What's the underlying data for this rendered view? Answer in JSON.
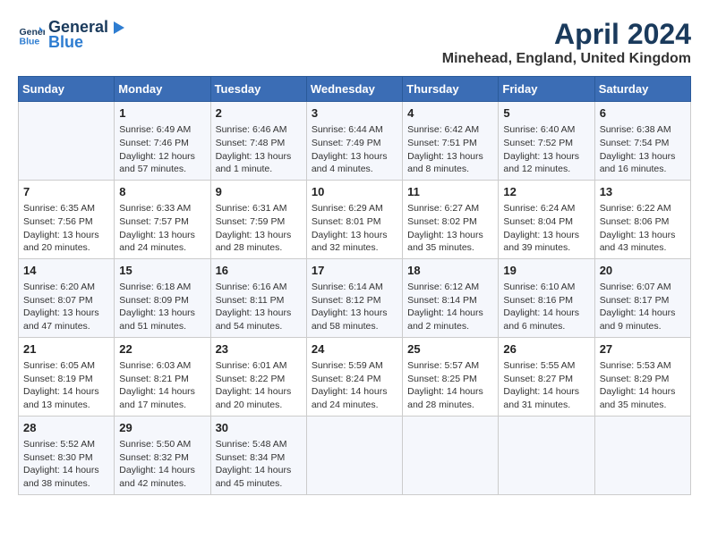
{
  "header": {
    "logo_line1": "General",
    "logo_line2": "Blue",
    "title": "April 2024",
    "subtitle": "Minehead, England, United Kingdom"
  },
  "weekdays": [
    "Sunday",
    "Monday",
    "Tuesday",
    "Wednesday",
    "Thursday",
    "Friday",
    "Saturday"
  ],
  "weeks": [
    [
      {
        "day": "",
        "sunrise": "",
        "sunset": "",
        "daylight": ""
      },
      {
        "day": "1",
        "sunrise": "Sunrise: 6:49 AM",
        "sunset": "Sunset: 7:46 PM",
        "daylight": "Daylight: 12 hours and 57 minutes."
      },
      {
        "day": "2",
        "sunrise": "Sunrise: 6:46 AM",
        "sunset": "Sunset: 7:48 PM",
        "daylight": "Daylight: 13 hours and 1 minute."
      },
      {
        "day": "3",
        "sunrise": "Sunrise: 6:44 AM",
        "sunset": "Sunset: 7:49 PM",
        "daylight": "Daylight: 13 hours and 4 minutes."
      },
      {
        "day": "4",
        "sunrise": "Sunrise: 6:42 AM",
        "sunset": "Sunset: 7:51 PM",
        "daylight": "Daylight: 13 hours and 8 minutes."
      },
      {
        "day": "5",
        "sunrise": "Sunrise: 6:40 AM",
        "sunset": "Sunset: 7:52 PM",
        "daylight": "Daylight: 13 hours and 12 minutes."
      },
      {
        "day": "6",
        "sunrise": "Sunrise: 6:38 AM",
        "sunset": "Sunset: 7:54 PM",
        "daylight": "Daylight: 13 hours and 16 minutes."
      }
    ],
    [
      {
        "day": "7",
        "sunrise": "Sunrise: 6:35 AM",
        "sunset": "Sunset: 7:56 PM",
        "daylight": "Daylight: 13 hours and 20 minutes."
      },
      {
        "day": "8",
        "sunrise": "Sunrise: 6:33 AM",
        "sunset": "Sunset: 7:57 PM",
        "daylight": "Daylight: 13 hours and 24 minutes."
      },
      {
        "day": "9",
        "sunrise": "Sunrise: 6:31 AM",
        "sunset": "Sunset: 7:59 PM",
        "daylight": "Daylight: 13 hours and 28 minutes."
      },
      {
        "day": "10",
        "sunrise": "Sunrise: 6:29 AM",
        "sunset": "Sunset: 8:01 PM",
        "daylight": "Daylight: 13 hours and 32 minutes."
      },
      {
        "day": "11",
        "sunrise": "Sunrise: 6:27 AM",
        "sunset": "Sunset: 8:02 PM",
        "daylight": "Daylight: 13 hours and 35 minutes."
      },
      {
        "day": "12",
        "sunrise": "Sunrise: 6:24 AM",
        "sunset": "Sunset: 8:04 PM",
        "daylight": "Daylight: 13 hours and 39 minutes."
      },
      {
        "day": "13",
        "sunrise": "Sunrise: 6:22 AM",
        "sunset": "Sunset: 8:06 PM",
        "daylight": "Daylight: 13 hours and 43 minutes."
      }
    ],
    [
      {
        "day": "14",
        "sunrise": "Sunrise: 6:20 AM",
        "sunset": "Sunset: 8:07 PM",
        "daylight": "Daylight: 13 hours and 47 minutes."
      },
      {
        "day": "15",
        "sunrise": "Sunrise: 6:18 AM",
        "sunset": "Sunset: 8:09 PM",
        "daylight": "Daylight: 13 hours and 51 minutes."
      },
      {
        "day": "16",
        "sunrise": "Sunrise: 6:16 AM",
        "sunset": "Sunset: 8:11 PM",
        "daylight": "Daylight: 13 hours and 54 minutes."
      },
      {
        "day": "17",
        "sunrise": "Sunrise: 6:14 AM",
        "sunset": "Sunset: 8:12 PM",
        "daylight": "Daylight: 13 hours and 58 minutes."
      },
      {
        "day": "18",
        "sunrise": "Sunrise: 6:12 AM",
        "sunset": "Sunset: 8:14 PM",
        "daylight": "Daylight: 14 hours and 2 minutes."
      },
      {
        "day": "19",
        "sunrise": "Sunrise: 6:10 AM",
        "sunset": "Sunset: 8:16 PM",
        "daylight": "Daylight: 14 hours and 6 minutes."
      },
      {
        "day": "20",
        "sunrise": "Sunrise: 6:07 AM",
        "sunset": "Sunset: 8:17 PM",
        "daylight": "Daylight: 14 hours and 9 minutes."
      }
    ],
    [
      {
        "day": "21",
        "sunrise": "Sunrise: 6:05 AM",
        "sunset": "Sunset: 8:19 PM",
        "daylight": "Daylight: 14 hours and 13 minutes."
      },
      {
        "day": "22",
        "sunrise": "Sunrise: 6:03 AM",
        "sunset": "Sunset: 8:21 PM",
        "daylight": "Daylight: 14 hours and 17 minutes."
      },
      {
        "day": "23",
        "sunrise": "Sunrise: 6:01 AM",
        "sunset": "Sunset: 8:22 PM",
        "daylight": "Daylight: 14 hours and 20 minutes."
      },
      {
        "day": "24",
        "sunrise": "Sunrise: 5:59 AM",
        "sunset": "Sunset: 8:24 PM",
        "daylight": "Daylight: 14 hours and 24 minutes."
      },
      {
        "day": "25",
        "sunrise": "Sunrise: 5:57 AM",
        "sunset": "Sunset: 8:25 PM",
        "daylight": "Daylight: 14 hours and 28 minutes."
      },
      {
        "day": "26",
        "sunrise": "Sunrise: 5:55 AM",
        "sunset": "Sunset: 8:27 PM",
        "daylight": "Daylight: 14 hours and 31 minutes."
      },
      {
        "day": "27",
        "sunrise": "Sunrise: 5:53 AM",
        "sunset": "Sunset: 8:29 PM",
        "daylight": "Daylight: 14 hours and 35 minutes."
      }
    ],
    [
      {
        "day": "28",
        "sunrise": "Sunrise: 5:52 AM",
        "sunset": "Sunset: 8:30 PM",
        "daylight": "Daylight: 14 hours and 38 minutes."
      },
      {
        "day": "29",
        "sunrise": "Sunrise: 5:50 AM",
        "sunset": "Sunset: 8:32 PM",
        "daylight": "Daylight: 14 hours and 42 minutes."
      },
      {
        "day": "30",
        "sunrise": "Sunrise: 5:48 AM",
        "sunset": "Sunset: 8:34 PM",
        "daylight": "Daylight: 14 hours and 45 minutes."
      },
      {
        "day": "",
        "sunrise": "",
        "sunset": "",
        "daylight": ""
      },
      {
        "day": "",
        "sunrise": "",
        "sunset": "",
        "daylight": ""
      },
      {
        "day": "",
        "sunrise": "",
        "sunset": "",
        "daylight": ""
      },
      {
        "day": "",
        "sunrise": "",
        "sunset": "",
        "daylight": ""
      }
    ]
  ]
}
